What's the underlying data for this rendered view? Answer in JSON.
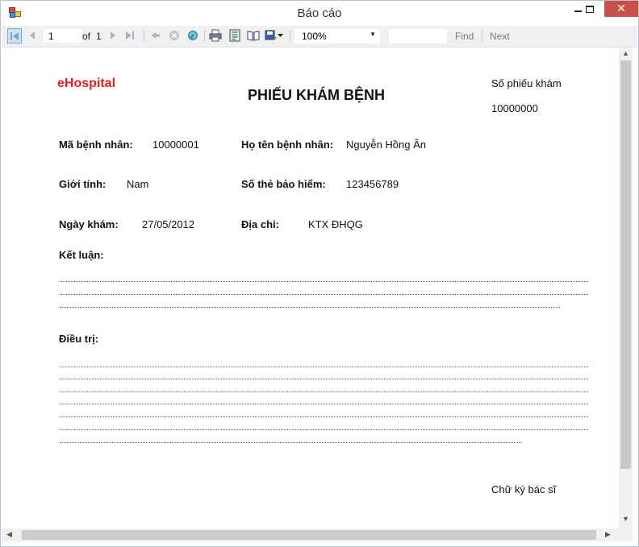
{
  "window": {
    "title": "Báo cáo",
    "close_label": "✕"
  },
  "toolbar": {
    "page_value": "1",
    "of_label": "of",
    "total_pages": "1",
    "zoom_value": "100%",
    "find_label": "Find",
    "next_label": "Next"
  },
  "report": {
    "hospital_name": "eHospital",
    "title": "PHIẾU KHÁM BỆNH",
    "form_number_label": "Số phiếu khám",
    "form_number_value": "10000000",
    "patient_id_label": "Mã bệnh nhân:",
    "patient_id_value": "10000001",
    "patient_name_label": "Họ tên bệnh nhân:",
    "patient_name_value": "Nguyễn Hồng Ân",
    "gender_label": "Giới tính:",
    "gender_value": "Nam",
    "insurance_label": "Số thẻ bảo hiểm:",
    "insurance_value": "123456789",
    "exam_date_label": "Ngày khám:",
    "exam_date_value": "27/05/2012",
    "address_label": "Địa chỉ:",
    "address_value": "KTX ĐHQG",
    "conclusion_label": "Kết luận:",
    "treatment_label": "Điều trị:",
    "signature_label": "Chữ ký bác sĩ"
  },
  "colors": {
    "brand": "#e02020",
    "close_button": "#c7504a"
  },
  "icons": [
    "app-icon",
    "first-page-icon",
    "previous-page-icon",
    "next-page-icon",
    "last-page-icon",
    "back-icon",
    "stop-icon",
    "refresh-icon",
    "print-icon",
    "print-layout-icon",
    "page-setup-icon",
    "export-icon",
    "dropdown-arrow-icon"
  ]
}
